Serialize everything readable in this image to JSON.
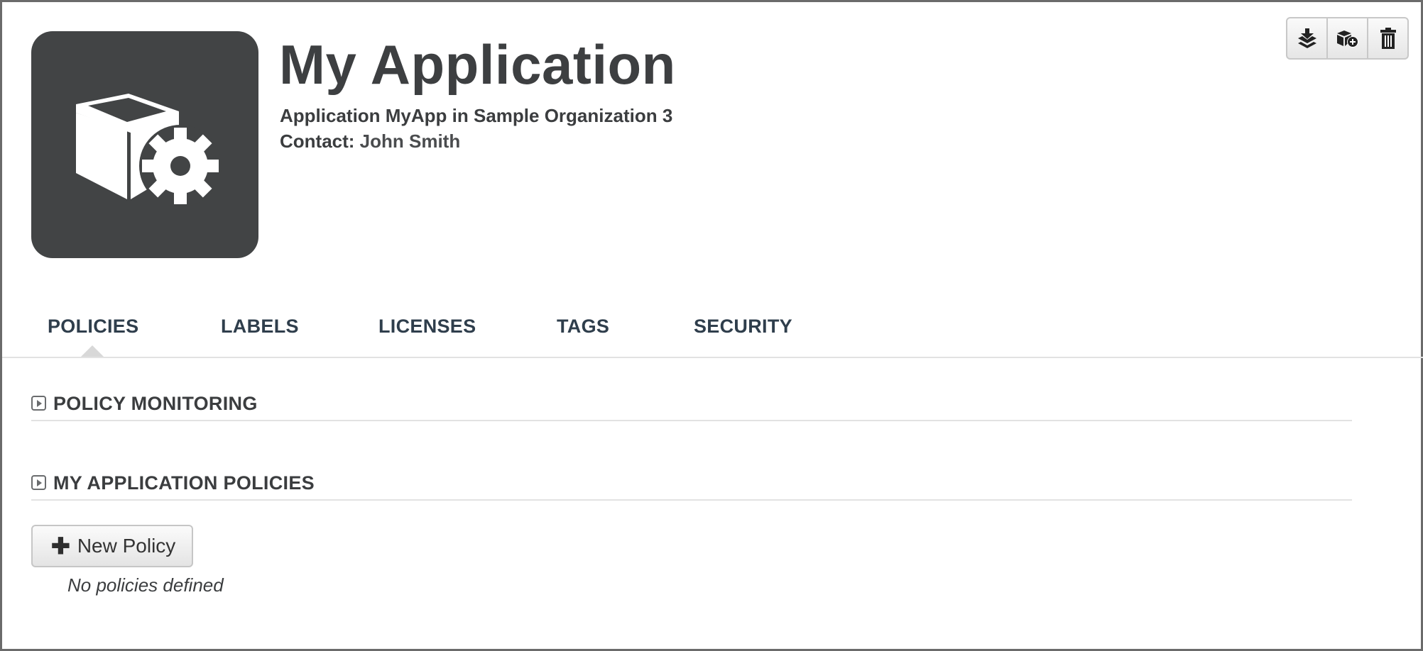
{
  "header": {
    "title": "My Application",
    "subtitle": "Application MyApp in Sample Organization 3",
    "contact_label": "Contact:",
    "contact_name": "John Smith",
    "app_icon": "cube-gear-icon"
  },
  "toolbar": {
    "buttons": [
      {
        "icon": "download-stack-icon"
      },
      {
        "icon": "add-component-icon"
      },
      {
        "icon": "trash-icon"
      }
    ]
  },
  "tabs": [
    {
      "label": "POLICIES",
      "active": true
    },
    {
      "label": "LABELS",
      "active": false
    },
    {
      "label": "LICENSES",
      "active": false
    },
    {
      "label": "TAGS",
      "active": false
    },
    {
      "label": "SECURITY",
      "active": false
    }
  ],
  "sections": [
    {
      "label": "POLICY MONITORING"
    },
    {
      "label": "MY APPLICATION POLICIES"
    }
  ],
  "policies": {
    "new_button_label": "New Policy",
    "empty_message": "No policies defined"
  },
  "colors": {
    "icon_bg": "#424445",
    "tab_text": "#2f3e4c",
    "text": "#3b3d3f"
  }
}
